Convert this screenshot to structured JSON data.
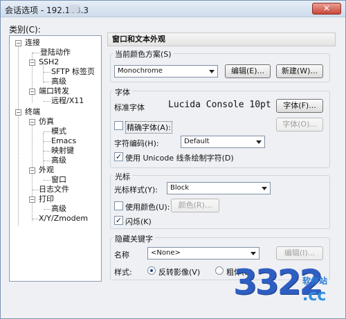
{
  "window": {
    "title": "会话选项 - 192.168.3"
  },
  "categories": {
    "label": "类别(C):",
    "items": [
      {
        "label": "连接"
      },
      {
        "label": "登陆动作"
      },
      {
        "label": "SSH2"
      },
      {
        "label": "SFTP 标签页"
      },
      {
        "label": "高级"
      },
      {
        "label": "端口转发"
      },
      {
        "label": "远程/X11"
      },
      {
        "label": "终端"
      },
      {
        "label": "仿真"
      },
      {
        "label": "模式"
      },
      {
        "label": "Emacs"
      },
      {
        "label": "映射键"
      },
      {
        "label": "高级"
      },
      {
        "label": "外观"
      },
      {
        "label": "窗口"
      },
      {
        "label": "日志文件"
      },
      {
        "label": "打印"
      },
      {
        "label": "高级"
      },
      {
        "label": "X/Y/Zmodem"
      }
    ]
  },
  "panel": {
    "header": "窗口和文本外观",
    "color_scheme": {
      "title": "当前颜色方案(S)",
      "value": "Monochrome",
      "edit_label": "编辑(E)...",
      "new_label": "新建(W)..."
    },
    "font": {
      "title": "字体",
      "standard_label": "标准字体",
      "standard_value": "Lucida Console 10pt",
      "font_button": "字体(F)...",
      "precise_label": "精确字体(A):",
      "precise_checked": false,
      "precise_button": "字体(O)...",
      "encoding_label": "字符编码(H):",
      "encoding_value": "Default",
      "unicode_label": "使用 Unicode 线条绘制字符(D)",
      "unicode_checked": true
    },
    "cursor": {
      "title": "光标",
      "style_label": "光标样式(Y):",
      "style_value": "Block",
      "use_color_label": "使用颜色(U):",
      "use_color_checked": false,
      "color_button": "颜色(R)...",
      "blink_label": "闪烁(K)",
      "blink_checked": true
    },
    "keyword": {
      "title": "隐藏关键字",
      "name_label": "名称",
      "name_value": "<None>",
      "edit_button": "编辑(I)...",
      "style_label": "样式:",
      "reverse_label": "反转影像(V)",
      "reverse_selected": true,
      "bold_label": "粗体(B)"
    }
  },
  "watermark": {
    "number": "3322",
    "tag": "软件站",
    "domain": ".cc"
  },
  "icons": {
    "close": "close-icon",
    "check": "check-icon",
    "dropdown": "chevron-down-icon"
  }
}
